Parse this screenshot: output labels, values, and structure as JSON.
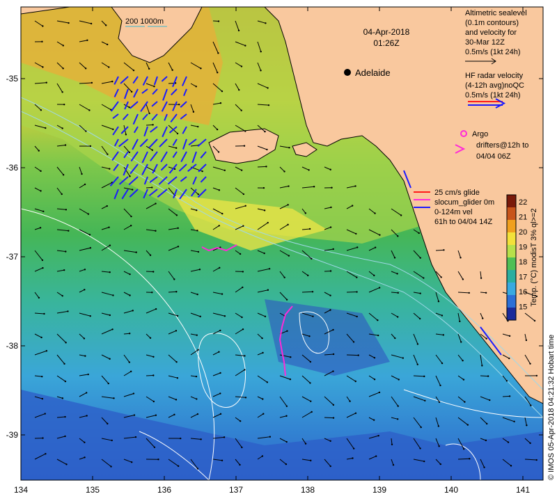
{
  "map": {
    "date": "04-Apr-2018",
    "time": "01:26Z",
    "city": "Adelaide",
    "scale_label": "200  1000m",
    "lon_ticks": [
      "134",
      "135",
      "136",
      "137",
      "138",
      "139",
      "140",
      "141"
    ],
    "lat_ticks": [
      "-35",
      "-36",
      "-37",
      "-38",
      "-39"
    ]
  },
  "legend": {
    "altimetric": [
      "Altimetric sealevel",
      "(0.1m contours)",
      "and velocity for",
      "30-Mar 12Z",
      "0.5m/s (1kt 24h)"
    ],
    "hf_radar": [
      "HF radar velocity",
      "(4-12h avg)noQC",
      "0.5m/s (1kt 24h)"
    ],
    "argo": "Argo",
    "drifters": [
      "drifters@12h to",
      "04/04 06Z"
    ],
    "glider": [
      "25 cm/s glide",
      "slocum_glider 0m",
      "0-124m vel",
      "61h to 04/04 14Z"
    ]
  },
  "colorbar": {
    "label": "Temp. (°C) modisT 3% ql>=2",
    "ticks": [
      "22",
      "21",
      "20",
      "19",
      "18",
      "17",
      "16",
      "15"
    ],
    "colors": [
      "#7a1a0a",
      "#c8541a",
      "#f0a01e",
      "#f3e13a",
      "#b7e04a",
      "#4fbf55",
      "#2aaea0",
      "#38a9e0",
      "#2b6fd6",
      "#1a2a9a"
    ]
  },
  "credit": "© IMOS 05-Apr-2018 04:21:32 Hobart time"
}
